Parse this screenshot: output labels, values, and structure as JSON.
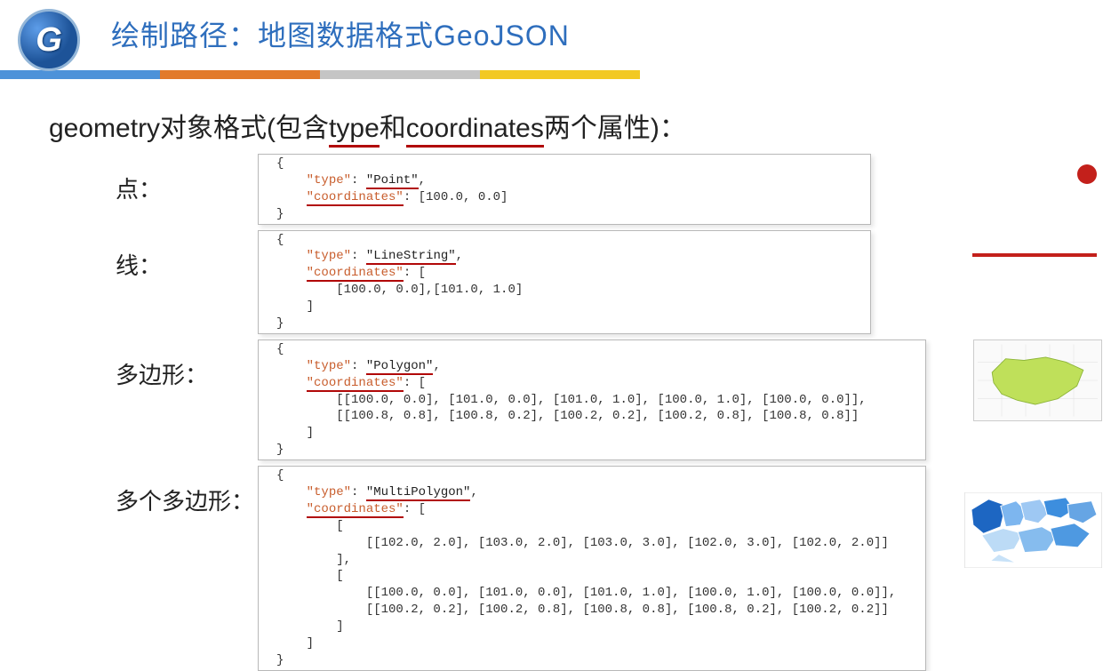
{
  "logo_letter": "G",
  "title": "绘制路径：地图数据格式GeoJSON",
  "subhead_prefix": "geometry对象格式(包含",
  "subhead_word1": "type",
  "subhead_mid": "和",
  "subhead_word2": "coordinates",
  "subhead_suffix": "两个属性)：",
  "rows": {
    "point": {
      "label": "点：",
      "type_key": "\"type\"",
      "type_val": "\"Point\"",
      "coord_key": "\"coordinates\"",
      "coord_val": ": [100.0, 0.0]"
    },
    "line": {
      "label": "线：",
      "type_key": "\"type\"",
      "type_val": "\"LineString\"",
      "coord_key": "\"coordinates\"",
      "coord_body": "        [100.0, 0.0],[101.0, 1.0]\n    ]"
    },
    "polygon": {
      "label": "多边形：",
      "type_key": "\"type\"",
      "type_val": "\"Polygon\"",
      "coord_key": "\"coordinates\"",
      "coord_body": "        [[100.0, 0.0], [101.0, 0.0], [101.0, 1.0], [100.0, 1.0], [100.0, 0.0]],\n        [[100.8, 0.8], [100.8, 0.2], [100.2, 0.2], [100.2, 0.8], [100.8, 0.8]]\n    ]"
    },
    "multipolygon": {
      "label": "多个多边形：",
      "type_key": "\"type\"",
      "type_val": "\"MultiPolygon\"",
      "coord_key": "\"coordinates\"",
      "coord_body": "        [\n            [[102.0, 2.0], [103.0, 2.0], [103.0, 3.0], [102.0, 3.0], [102.0, 2.0]]\n        ],\n        [\n            [[100.0, 0.0], [101.0, 0.0], [101.0, 1.0], [100.0, 1.0], [100.0, 0.0]],\n            [[100.2, 0.2], [100.2, 0.8], [100.8, 0.8], [100.8, 0.2], [100.2, 0.2]]\n        ]\n    ]"
    }
  }
}
